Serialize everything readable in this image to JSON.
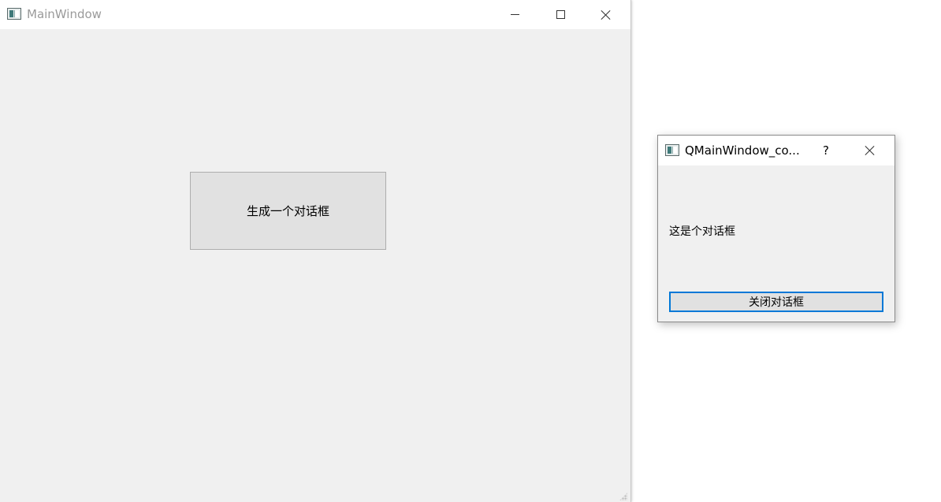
{
  "main_window": {
    "title": "MainWindow",
    "generate_button_label": "生成一个对话框"
  },
  "dialog": {
    "title": "QMainWindow_co...",
    "help_label": "?",
    "message": "这是个对话框",
    "close_button_label": "关闭对话框"
  },
  "colors": {
    "window_bg": "#f0f0f0",
    "titlebar_bg": "#ffffff",
    "button_bg": "#e1e1e1",
    "focus_border": "#0078d7"
  },
  "icons": {
    "app": "app-window-icon",
    "minimize": "minimize-icon",
    "maximize": "maximize-icon",
    "close": "close-icon",
    "help": "help-icon"
  }
}
